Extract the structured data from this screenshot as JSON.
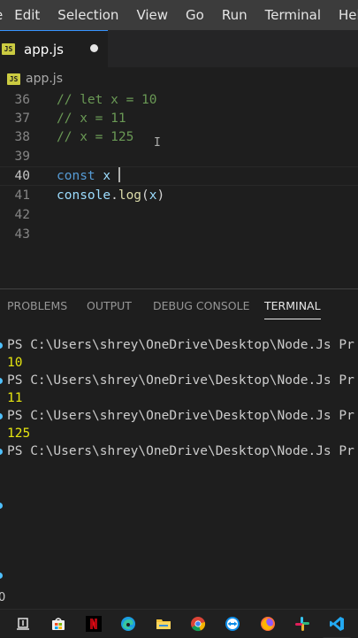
{
  "menubar": {
    "items": [
      "e",
      "Edit",
      "Selection",
      "View",
      "Go",
      "Run",
      "Terminal",
      "Help"
    ]
  },
  "tab": {
    "label": "app.js",
    "icon_text": "JS"
  },
  "breadcrumb": {
    "label": "app.js",
    "icon_text": "JS"
  },
  "editor": {
    "lines": [
      {
        "number": "36",
        "comment": "// let x = 10"
      },
      {
        "number": "37",
        "comment": "// x = 11"
      },
      {
        "number": "38",
        "comment": "// x = 125"
      },
      {
        "number": "39"
      },
      {
        "number": "40",
        "keyword": "const",
        "identifier": "x"
      },
      {
        "number": "41",
        "object": "console",
        "dot": ".",
        "method": "log",
        "open": "(",
        "arg": "x",
        "close": ")"
      },
      {
        "number": "42"
      },
      {
        "number": "43"
      }
    ]
  },
  "panel": {
    "tabs": [
      "PROBLEMS",
      "OUTPUT",
      "DEBUG CONSOLE",
      "TERMINAL"
    ],
    "active_tab": "TERMINAL"
  },
  "terminal": {
    "lines": [
      "PS C:\\Users\\shrey\\OneDrive\\Desktop\\Node.Js Pr",
      "10",
      "PS C:\\Users\\shrey\\OneDrive\\Desktop\\Node.Js Pr",
      "11",
      "PS C:\\Users\\shrey\\OneDrive\\Desktop\\Node.Js Pr",
      "125",
      "PS C:\\Users\\shrey\\OneDrive\\Desktop\\Node.Js Pr"
    ]
  },
  "statusbar": {
    "fragment": "0"
  },
  "colors": {
    "accent": "#3794ff",
    "comment": "#6a9955",
    "keyword": "#569cd6",
    "output": "#e5e510"
  },
  "taskbar": {
    "icons": [
      "task-view-icon",
      "store-icon",
      "netflix-icon",
      "edge-icon",
      "file-explorer-icon",
      "chrome-icon",
      "teamviewer-icon",
      "firefox-icon",
      "slack-icon",
      "vscode-icon"
    ]
  }
}
